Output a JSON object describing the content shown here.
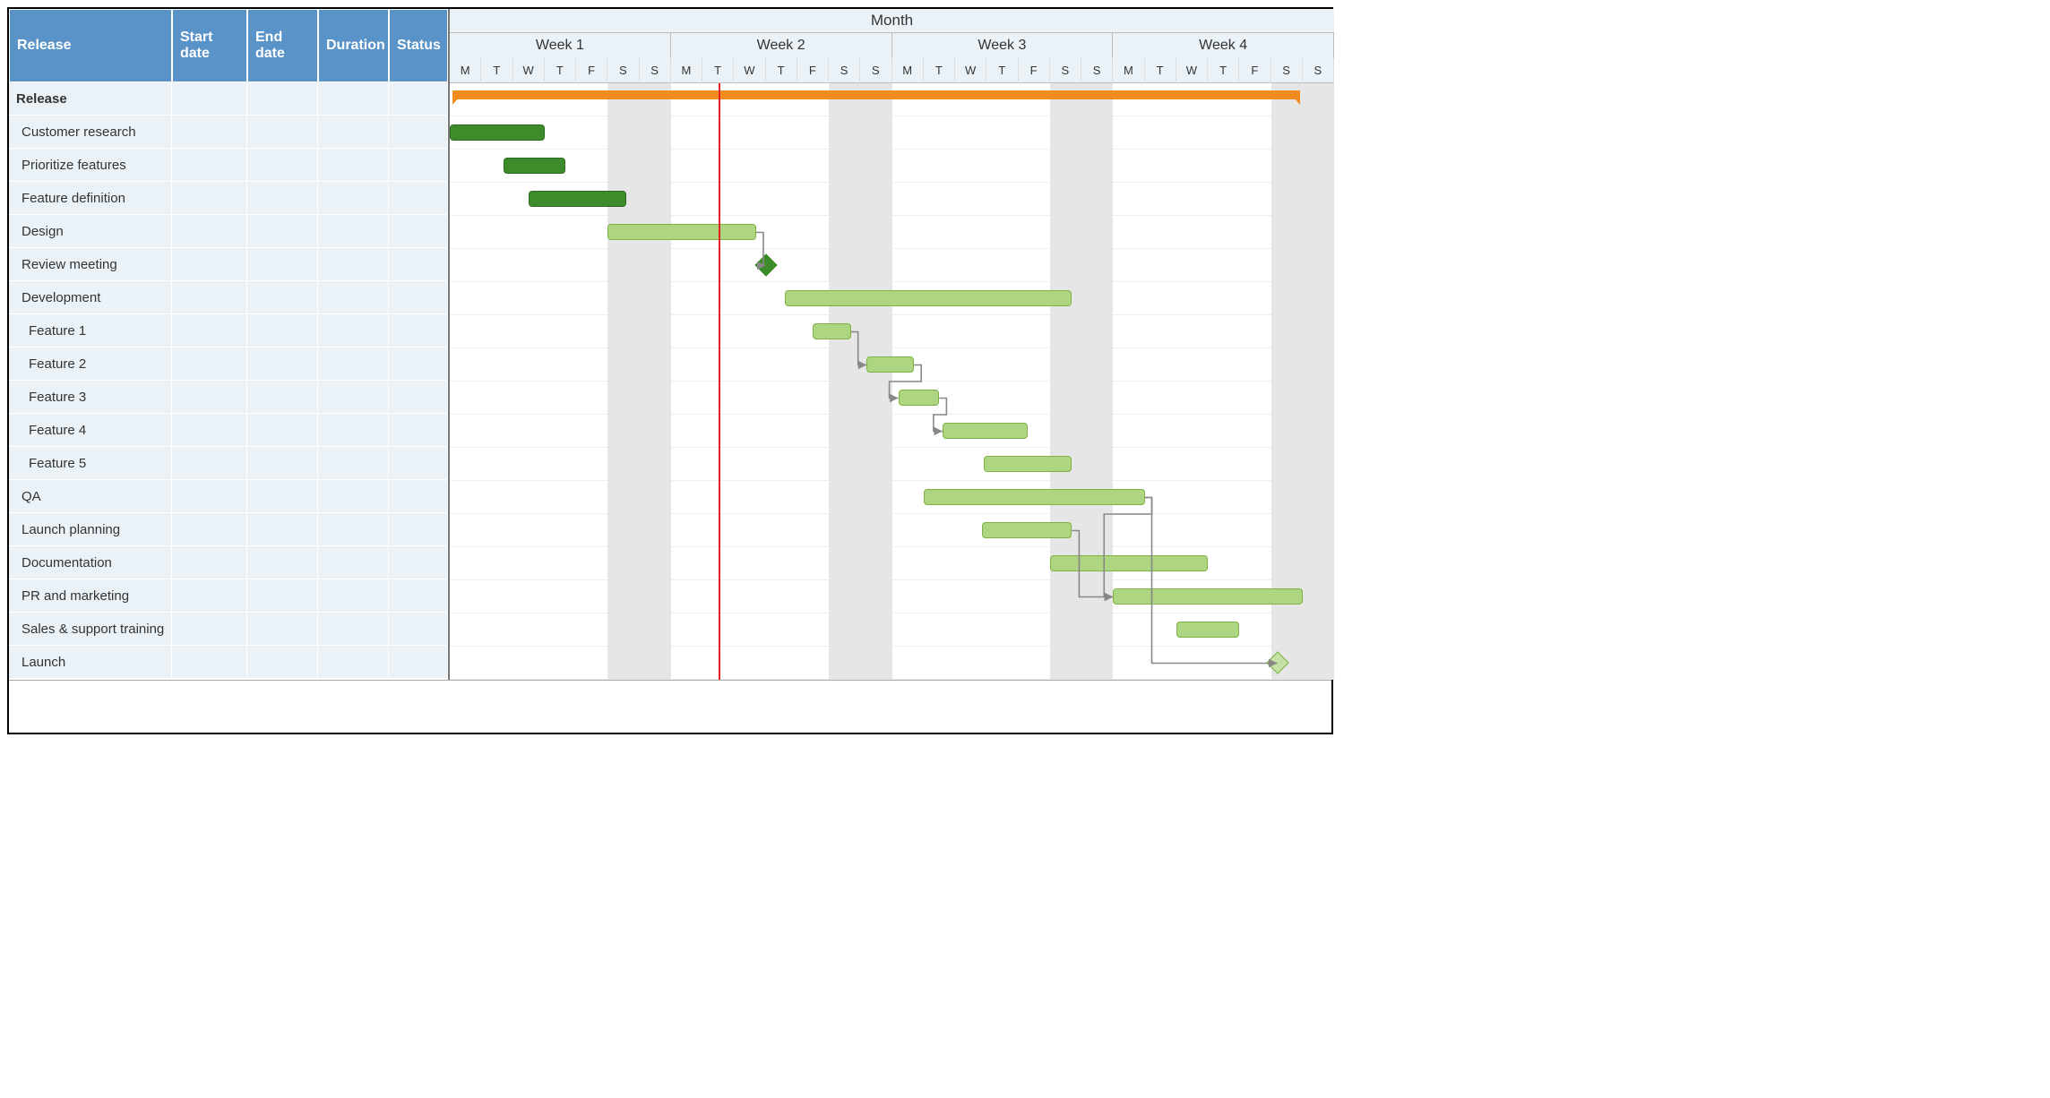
{
  "chart_data": {
    "type": "gantt",
    "time_unit": "days",
    "x_axis_title": "Month",
    "week_labels": [
      "Week 1",
      "Week 2",
      "Week 3",
      "Week 4"
    ],
    "day_labels": [
      "M",
      "T",
      "W",
      "T",
      "F",
      "S",
      "S"
    ],
    "days_total": 28,
    "today_day_index": 8.5,
    "weekend_day_indices": [
      5,
      6,
      12,
      13,
      19,
      20,
      26,
      27
    ],
    "columns": [
      "Release",
      "Start date",
      "End date",
      "Duration",
      "Status"
    ],
    "tasks": [
      {
        "id": "release",
        "name": "Release",
        "indent": 0,
        "type": "summary",
        "start": 0,
        "end": 27,
        "complete": false
      },
      {
        "id": "custres",
        "name": "Customer research",
        "indent": 1,
        "type": "task",
        "start": 0,
        "end": 3,
        "complete": true
      },
      {
        "id": "priofeat",
        "name": "Prioritize features",
        "indent": 1,
        "type": "task",
        "start": 1.7,
        "end": 3.65,
        "complete": true
      },
      {
        "id": "featdef",
        "name": "Feature definition",
        "indent": 1,
        "type": "task",
        "start": 2.5,
        "end": 5.6,
        "complete": true
      },
      {
        "id": "design",
        "name": "Design",
        "indent": 1,
        "type": "task",
        "start": 5,
        "end": 9.7,
        "complete": false
      },
      {
        "id": "revmtg",
        "name": "Review meeting",
        "indent": 1,
        "type": "milestone",
        "start": 10,
        "end": 10,
        "complete": true
      },
      {
        "id": "dev",
        "name": "Development",
        "indent": 1,
        "type": "task",
        "start": 10.6,
        "end": 19.7,
        "complete": false
      },
      {
        "id": "feat1",
        "name": "Feature 1",
        "indent": 2,
        "type": "task",
        "start": 11.5,
        "end": 12.7,
        "complete": false
      },
      {
        "id": "feat2",
        "name": "Feature 2",
        "indent": 2,
        "type": "task",
        "start": 13.2,
        "end": 14.7,
        "complete": false
      },
      {
        "id": "feat3",
        "name": "Feature 3",
        "indent": 2,
        "type": "task",
        "start": 14.2,
        "end": 15.5,
        "complete": false
      },
      {
        "id": "feat4",
        "name": "Feature 4",
        "indent": 2,
        "type": "task",
        "start": 15.6,
        "end": 18.3,
        "complete": false
      },
      {
        "id": "feat5",
        "name": "Feature 5",
        "indent": 2,
        "type": "task",
        "start": 16.9,
        "end": 19.7,
        "complete": false
      },
      {
        "id": "qa",
        "name": "QA",
        "indent": 1,
        "type": "task",
        "start": 15,
        "end": 22,
        "complete": false
      },
      {
        "id": "launchp",
        "name": "Launch planning",
        "indent": 1,
        "type": "task",
        "start": 16.85,
        "end": 19.7,
        "complete": false
      },
      {
        "id": "docs",
        "name": "Documentation",
        "indent": 1,
        "type": "task",
        "start": 19,
        "end": 24,
        "complete": false
      },
      {
        "id": "prm",
        "name": "PR and  marketing",
        "indent": 1,
        "type": "task",
        "start": 21,
        "end": 27,
        "complete": false
      },
      {
        "id": "sales",
        "name": "Sales & support training",
        "indent": 1,
        "type": "task",
        "start": 23,
        "end": 25,
        "complete": false
      },
      {
        "id": "launch",
        "name": "Launch",
        "indent": 1,
        "type": "milestone",
        "start": 26.2,
        "end": 26.2,
        "complete": false
      }
    ],
    "dependencies": [
      {
        "from": "design",
        "to": "revmtg"
      },
      {
        "from": "feat1",
        "to": "feat2"
      },
      {
        "from": "feat2",
        "to": "feat3"
      },
      {
        "from": "feat3",
        "to": "feat4"
      },
      {
        "from": "qa",
        "to": "prm"
      },
      {
        "from": "launchp",
        "to": "prm"
      },
      {
        "from": "qa",
        "to": "launch"
      }
    ]
  },
  "header": {
    "name": "Release",
    "sd": "Start date",
    "ed": "End date",
    "du": "Duration",
    "st": "Status",
    "month": "Month"
  },
  "colors": {
    "header_bg": "#5a93c8",
    "row_bg": "#eaf2f8",
    "bar_done": "#3e8b2b",
    "bar_open": "#aed581",
    "summary": "#f28c1e",
    "today": "#e42020"
  }
}
